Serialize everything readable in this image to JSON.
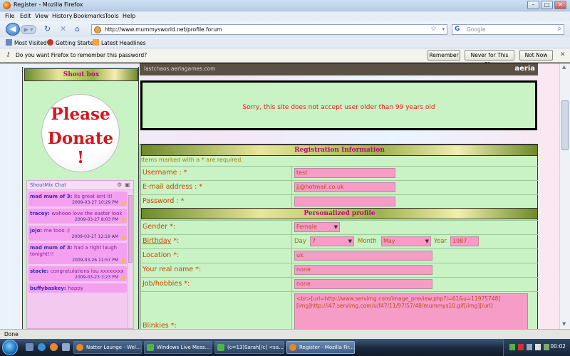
{
  "window": {
    "title": "Register - Mozilla Firefox"
  },
  "menu": [
    "File",
    "Edit",
    "View",
    "History",
    "Bookmarks",
    "Tools",
    "Help"
  ],
  "nav": {
    "url": "http://www.mummysworld.net/profile.forum",
    "search_placeholder": "Google",
    "search_engine_glyph": "G"
  },
  "bookmarks": [
    "Most Visited",
    "Getting Started",
    "Latest Headlines"
  ],
  "password_bar": {
    "message": "Do you want Firefox to remember this password?",
    "buttons": [
      "Remember",
      "Never for This Site",
      "Not Now"
    ]
  },
  "sidebar": {
    "shoutbox_title": "Shout box",
    "donate_line1": "Please",
    "donate_line2": "Donate !",
    "shoutmix_title": "ShoutMix Chat",
    "messages": [
      {
        "name": "mad mum of 3:",
        "text": "its great isnt it!",
        "date": "2009-03-27 10:29 PM"
      },
      {
        "name": "tracey:",
        "text": "wahooo love the easter look",
        "date": "2009-03-27 8:03 PM"
      },
      {
        "name": "jojo:",
        "text": "me tooo :)",
        "date": "2009-03-27 12:19 AM"
      },
      {
        "name": "mad mum of 3:",
        "text": "had a right laugh tonight!!!",
        "date": "2009-03-26 11:57 PM"
      },
      {
        "name": "stacie:",
        "text": "congratulations lau xxxxxxxx",
        "date": "2009-03-23 3:23 PM"
      },
      {
        "name": "buffybaskey:",
        "text": "happy",
        "date": ""
      }
    ]
  },
  "banner": {
    "url_text": "lastchaos.aeriagames.com",
    "brand": "aeria"
  },
  "error_message": "Sorry, this site does not accept user older than 99 years old",
  "registration": {
    "section_title": "Registration Information",
    "required_note": "Items marked with a * are required.",
    "username_label": "Username : *",
    "username_value": "test",
    "email_label": "E-mail address : *",
    "email_value": "jj@hotmail.co.uk",
    "password_label": "Password : *",
    "password_value": ""
  },
  "profile": {
    "section_title": "Personalized profile",
    "gender_label": "Gender *:",
    "gender_value": "Female",
    "birthday_label": "Birthday",
    "birthday_suffix": " *:",
    "day_label": "Day",
    "day_value": "7",
    "month_label": "Month",
    "month_value": "May",
    "year_label": "Year",
    "year_value": "1987",
    "location_label": "Location *:",
    "location_value": "uk",
    "realname_label": "Your real name *:",
    "realname_value": "none",
    "job_label": "Job/hobbies *:",
    "job_value": "none",
    "blinkies_label": "Blinkies *:",
    "blinkies_value": "<br>[url=http://www.servimg.com/image_preview.php?i=61&u=11975748][img]http://i47.servimg.com/u/f47/11/97/57/48/mummys10.gif[/img][/url]"
  },
  "status": "Done",
  "taskbar": {
    "tasks": [
      "Natter Lounge - Wel...",
      "Windows Live Mess...",
      "(c=13)Sarah[/c] <sa...",
      "Register - Mozilla Fir..."
    ],
    "clock": "00:02"
  },
  "colors": {
    "page_green": "#c9f3c4",
    "label_orange": "#c14a00",
    "field_pink": "#f79bc7",
    "section_title": "#b40f6a",
    "error_red": "#e21b1b"
  }
}
